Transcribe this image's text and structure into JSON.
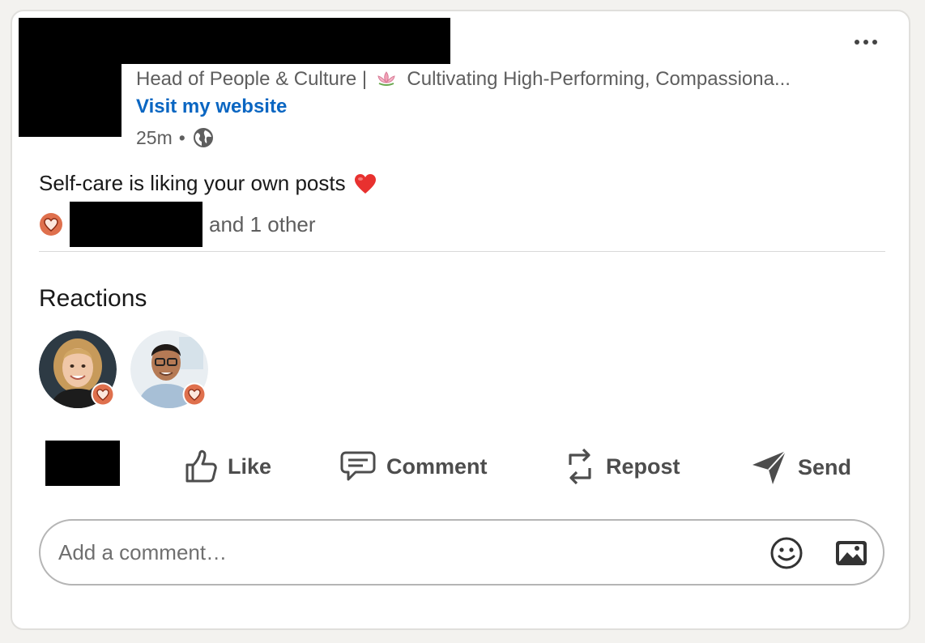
{
  "author": {
    "headline_prefix": "Head of People & Culture |",
    "headline_rest": "Cultivating High-Performing, Compassiona...",
    "website_link": "Visit my website",
    "post_age": "25m",
    "separator": "•",
    "visibility_icon": "globe-icon"
  },
  "post": {
    "text": "Self-care is liking your own posts",
    "emoji": "heart-emoji"
  },
  "reactions_summary": {
    "reaction_icon": "love-reaction-icon",
    "suffix": "and 1 other"
  },
  "reactions_section": {
    "title": "Reactions",
    "reactors": [
      {
        "avatar": "woman-curly-blonde-hair",
        "reaction": "love"
      },
      {
        "avatar": "man-glasses",
        "reaction": "love"
      }
    ]
  },
  "actions": {
    "like": "Like",
    "comment": "Comment",
    "repost": "Repost",
    "send": "Send"
  },
  "comment_box": {
    "placeholder": "Add a comment…",
    "emoji_icon": "smiley-icon",
    "image_icon": "image-icon"
  },
  "colors": {
    "link": "#0a66c2",
    "love_reaction": "#df704d",
    "text_secondary": "#5e5e5e"
  }
}
